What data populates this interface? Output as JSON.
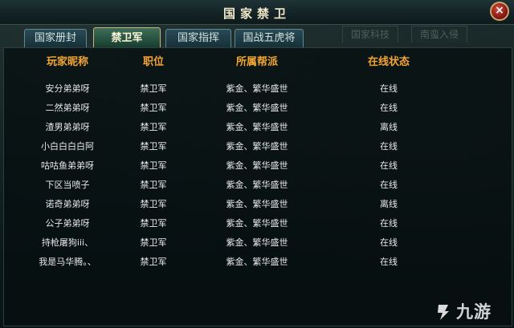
{
  "window": {
    "title": "国家禁卫",
    "close_label": "×"
  },
  "background_tabs": [
    "国家科技",
    "南蛮入侵"
  ],
  "tabs": [
    {
      "label": "国家册封"
    },
    {
      "label": "禁卫军"
    },
    {
      "label": "国家指挥"
    },
    {
      "label": "国战五虎将"
    }
  ],
  "active_tab": "禁卫军",
  "table": {
    "columns": [
      "玩家昵称",
      "职位",
      "所属帮派",
      "在线状态"
    ],
    "rows": [
      {
        "name": "安分弟弟呀",
        "position": "禁卫军",
        "guild": "紫金、繁华盛世",
        "status": "在线"
      },
      {
        "name": "二然弟弟呀",
        "position": "禁卫军",
        "guild": "紫金、繁华盛世",
        "status": "在线"
      },
      {
        "name": "渣男弟弟呀",
        "position": "禁卫军",
        "guild": "紫金、繁华盛世",
        "status": "离线"
      },
      {
        "name": "小白白白白阿",
        "position": "禁卫军",
        "guild": "紫金、繁华盛世",
        "status": "在线"
      },
      {
        "name": "咕咕鱼弟弟呀",
        "position": "禁卫军",
        "guild": "紫金、繁华盛世",
        "status": "在线"
      },
      {
        "name": "下区当喷子",
        "position": "禁卫军",
        "guild": "紫金、繁华盛世",
        "status": "在线"
      },
      {
        "name": "诺奇弟弟呀",
        "position": "禁卫军",
        "guild": "紫金、繁华盛世",
        "status": "离线"
      },
      {
        "name": "公子弟弟呀",
        "position": "禁卫军",
        "guild": "紫金、繁华盛世",
        "status": "在线"
      },
      {
        "name": "持枪屠狗iii、",
        "position": "禁卫军",
        "guild": "紫金、繁华盛世",
        "status": "在线"
      },
      {
        "name": "我是马华腾。、",
        "position": "禁卫军",
        "guild": "紫金、繁华盛世",
        "status": "在线"
      }
    ]
  },
  "watermark": {
    "icon": "9game-logo-icon",
    "text": "九游"
  }
}
